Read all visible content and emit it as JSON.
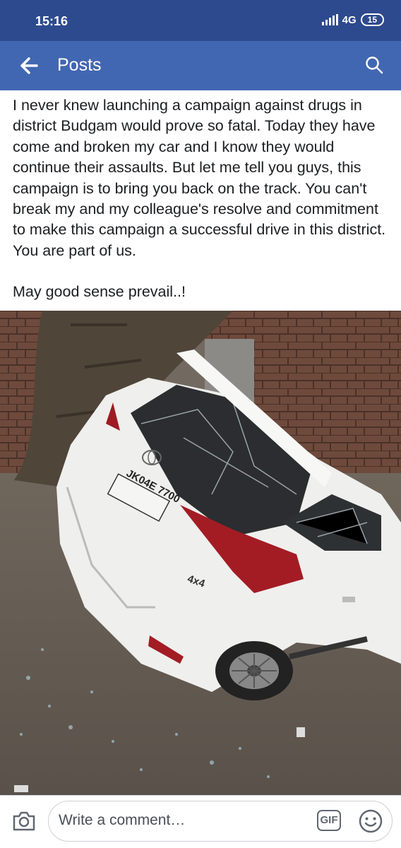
{
  "status_bar": {
    "time": "15:16",
    "network": "4G",
    "battery": "15"
  },
  "app_bar": {
    "title": "Posts",
    "back_icon": "arrow-left-icon",
    "search_icon": "search-icon"
  },
  "post": {
    "paragraphs": [
      "I never knew launching a  campaign against drugs in district Budgam would prove so fatal. Today they have come and broken my car and I know  they would continue their assaults.  But let me tell you guys, this campaign is to bring you back on the track.  You can't break my and my colleague's resolve and commitment to make this campaign a successful drive in this district. You are part of us.",
      "May good sense prevail..!"
    ],
    "photo": {
      "plate": "JK04E 7700",
      "badge": "4x4"
    }
  },
  "comment_bar": {
    "placeholder": "Write a comment…",
    "gif_label": "GIF",
    "camera_icon": "camera-icon",
    "emoji_icon": "smiley-icon"
  },
  "colors": {
    "status_bar": "#2e4a8e",
    "app_bar": "#4267b2",
    "text": "#1c1e21"
  }
}
